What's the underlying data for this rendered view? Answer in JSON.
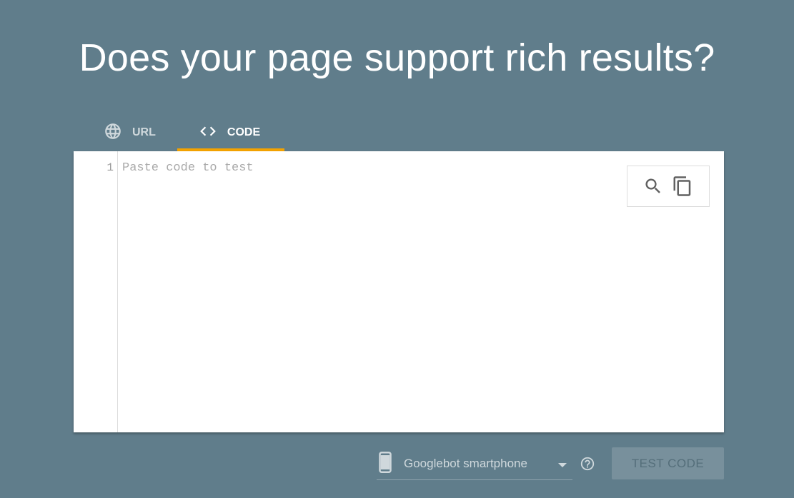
{
  "header": {
    "title": "Does your page support rich results?"
  },
  "tabs": [
    {
      "label": "URL",
      "icon": "globe-icon",
      "active": false
    },
    {
      "label": "CODE",
      "icon": "code-icon",
      "active": true
    }
  ],
  "editor": {
    "line_number": "1",
    "placeholder": "Paste code to test",
    "tools": [
      "search-icon",
      "copy-icon"
    ]
  },
  "footer": {
    "device_select": "Googlebot smartphone",
    "device_icon": "smartphone-icon",
    "help_icon": "help-icon",
    "test_button": "TEST CODE",
    "test_button_disabled": true
  },
  "colors": {
    "background": "#607d8b",
    "tab_indicator": "#f4a300"
  }
}
